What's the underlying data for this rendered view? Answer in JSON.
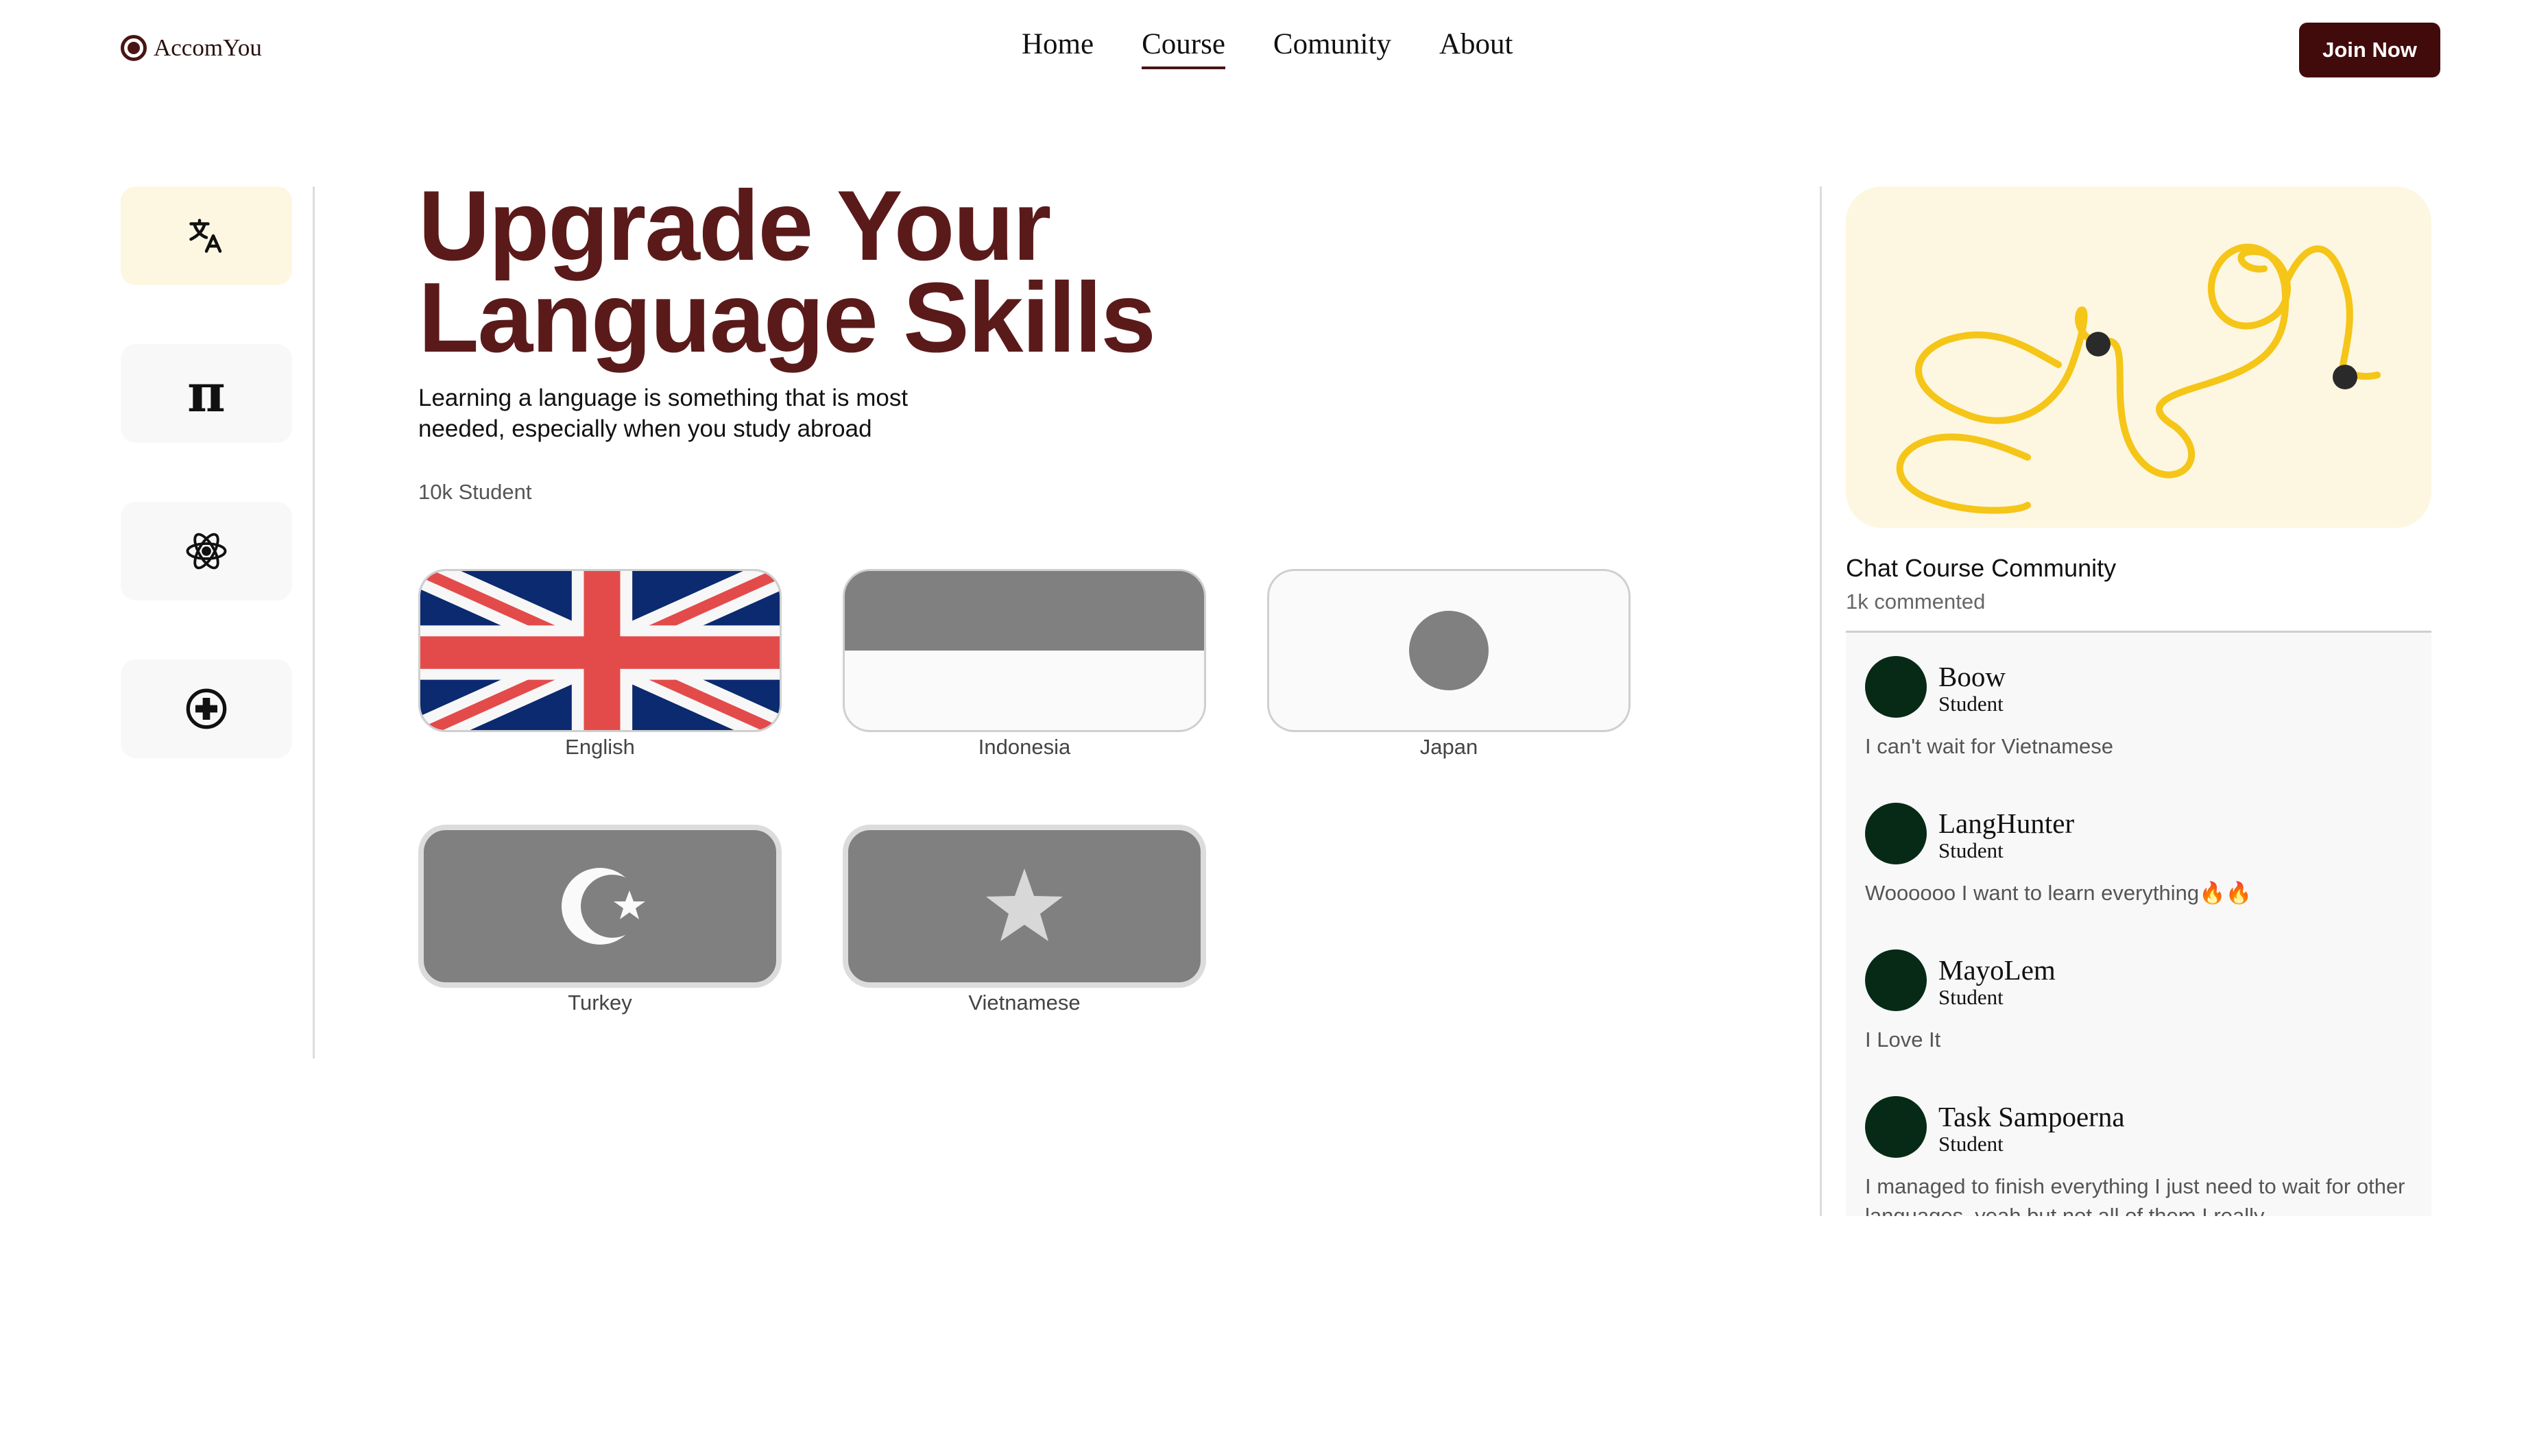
{
  "header": {
    "logo_text": "AccomYou",
    "nav": [
      {
        "label": "Home",
        "active": false
      },
      {
        "label": "Course",
        "active": true
      },
      {
        "label": "Comunity",
        "active": false
      },
      {
        "label": "About",
        "active": false
      }
    ],
    "join_label": "Join Now"
  },
  "sidebar": {
    "items": [
      {
        "icon": "translate-icon",
        "active": true
      },
      {
        "icon": "pi-icon",
        "active": false
      },
      {
        "icon": "atom-icon",
        "active": false
      },
      {
        "icon": "medical-cross-icon",
        "active": false
      }
    ]
  },
  "hero": {
    "title_line1": "Upgrade Your",
    "title_line2": "Language Skills",
    "subtitle_line1": "Learning a language is something that is most",
    "subtitle_line2": "needed, especially when you study abroad",
    "students": "10k Student"
  },
  "languages": [
    {
      "label": "English",
      "flag": "uk-flag-icon"
    },
    {
      "label": "Indonesia",
      "flag": "indonesia-flag-icon"
    },
    {
      "label": "Japan",
      "flag": "japan-flag-icon"
    },
    {
      "label": "Turkey",
      "flag": "turkey-flag-icon"
    },
    {
      "label": "Vietnamese",
      "flag": "vietnam-flag-icon"
    }
  ],
  "community": {
    "title": "Chat Course Community",
    "count": "1k commented",
    "comments": [
      {
        "name": "Boow",
        "role": "Student",
        "text": "I can't wait for Vietnamese"
      },
      {
        "name": "LangHunter",
        "role": "Student",
        "text": "Woooooo I want to learn everything🔥🔥"
      },
      {
        "name": "MayoLem",
        "role": "Student",
        "text": "I Love It"
      },
      {
        "name": "Task Sampoerna",
        "role": "Student",
        "text": "I managed to finish everything I just need to wait for other languages, yeah but not all of them I really"
      }
    ]
  },
  "colors": {
    "brand": "#420b0b",
    "title": "#5b1a1a",
    "avatar": "#072a17",
    "cream": "#fdf7e1",
    "squiggle": "#f5c518"
  }
}
